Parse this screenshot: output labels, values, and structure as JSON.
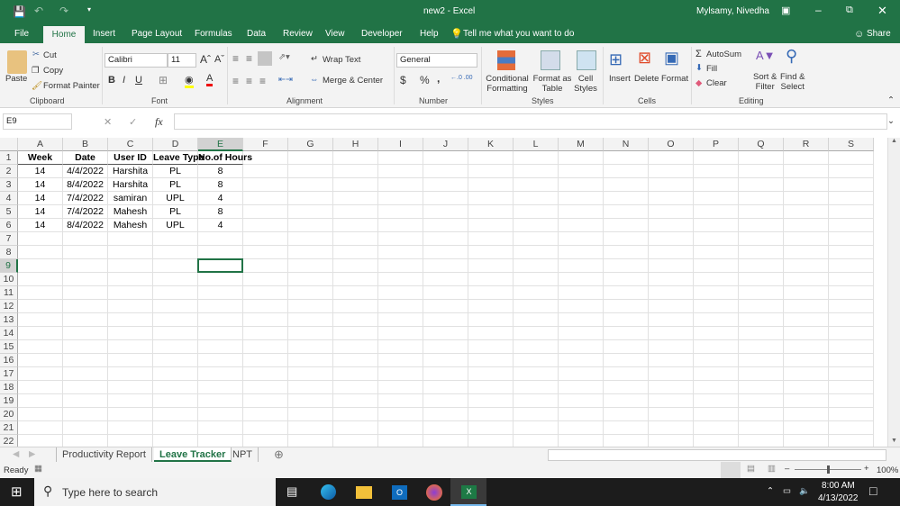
{
  "window": {
    "title": "new2  -  Excel",
    "user": "Mylsamy, Nivedha"
  },
  "menu_tabs": [
    "File",
    "Home",
    "Insert",
    "Page Layout",
    "Formulas",
    "Data",
    "Review",
    "View",
    "Developer",
    "Help"
  ],
  "tell_me": "Tell me what you want to do",
  "share": "Share",
  "ribbon": {
    "clipboard": {
      "paste": "Paste",
      "cut": "Cut",
      "copy": "Copy",
      "format_painter": "Format Painter",
      "label": "Clipboard"
    },
    "font": {
      "name": "Calibri",
      "size": "11",
      "label": "Font",
      "bold": "B",
      "italic": "I",
      "underline": "U"
    },
    "alignment": {
      "wrap": "Wrap Text",
      "merge": "Merge & Center",
      "label": "Alignment"
    },
    "number": {
      "format": "General",
      "currency": "$",
      "percent": "%",
      "comma": ",",
      "label": "Number"
    },
    "styles": {
      "conditional": [
        "Conditional",
        "Formatting"
      ],
      "format_table": [
        "Format as",
        "Table"
      ],
      "cell_styles": [
        "Cell",
        "Styles"
      ],
      "label": "Styles"
    },
    "cells": {
      "insert": "Insert",
      "delete": "Delete",
      "format": "Format",
      "label": "Cells"
    },
    "editing": {
      "autosum": "AutoSum",
      "fill": "Fill",
      "clear": "Clear",
      "sort": [
        "Sort &",
        "Filter"
      ],
      "find": [
        "Find &",
        "Select"
      ],
      "label": "Editing"
    }
  },
  "formula_bar": {
    "name_box": "E9",
    "fx": "fx",
    "value": ""
  },
  "columns": [
    "A",
    "B",
    "C",
    "D",
    "E",
    "F",
    "G",
    "H",
    "I",
    "J",
    "K",
    "L",
    "M",
    "N",
    "O",
    "P",
    "Q",
    "R",
    "S"
  ],
  "rows": [
    [
      "Week",
      "Date",
      "User ID",
      "Leave Type",
      "No.of Hours"
    ],
    [
      "14",
      "4/4/2022",
      "Harshita",
      "PL",
      "8"
    ],
    [
      "14",
      "8/4/2022",
      "Harshita",
      "PL",
      "8"
    ],
    [
      "14",
      "7/4/2022",
      "samiran",
      "UPL",
      "4"
    ],
    [
      "14",
      "7/4/2022",
      "Mahesh",
      "PL",
      "8"
    ],
    [
      "14",
      "8/4/2022",
      "Mahesh",
      "UPL",
      "4"
    ]
  ],
  "row_count": 22,
  "selected_cell": "E9",
  "sheets": [
    "Productivity Report",
    "Leave Tracker",
    "NPT"
  ],
  "active_sheet": "Leave Tracker",
  "status": {
    "ready": "Ready",
    "zoom": "100%"
  },
  "taskbar": {
    "search": "Type here to search",
    "time": "8:00 AM",
    "date": "4/13/2022"
  },
  "colors": {
    "excel_green": "#217346",
    "ribbon": "#f3f3f3",
    "taskbar": "#1c1c1c"
  }
}
